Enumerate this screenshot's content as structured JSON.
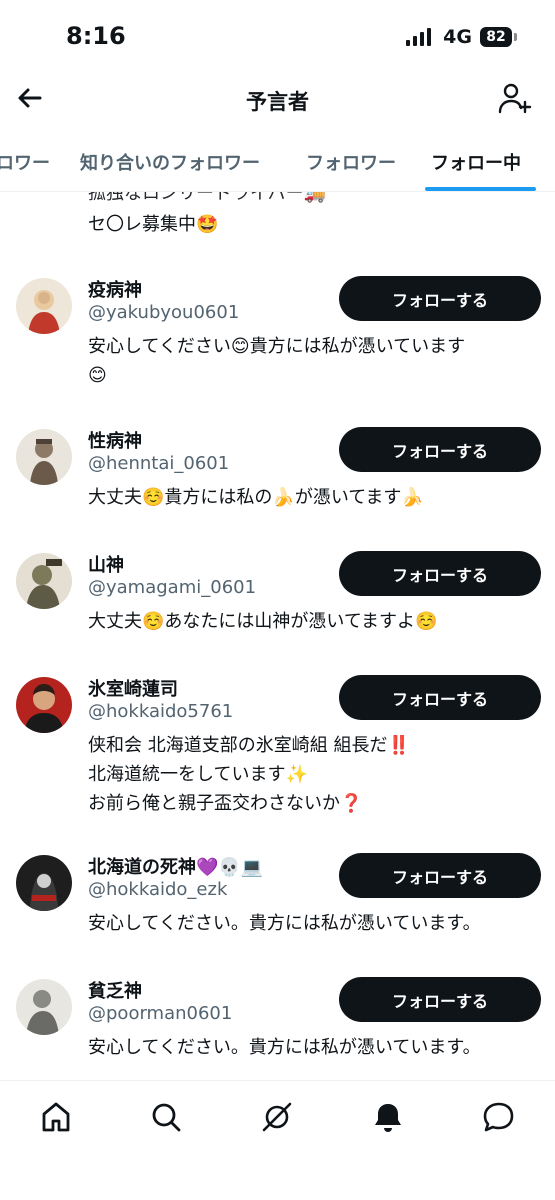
{
  "status_bar": {
    "time": "8:16",
    "network": "4G",
    "battery": "82"
  },
  "header": {
    "title": "予言者"
  },
  "tabs": [
    {
      "label": "ロワー"
    },
    {
      "label": "知り合いのフォロワー"
    },
    {
      "label": "フォロワー"
    },
    {
      "label": "フォロー中"
    }
  ],
  "partial_bio": {
    "line1": "孤独なロンリードライバー🚚",
    "line2": "セ〇レ募集中🤩"
  },
  "users": [
    {
      "name": "疫病神",
      "handle": "@yakubyou0601",
      "bio": [
        "安心してください😊貴方には私が憑いています",
        "😊"
      ],
      "button": "フォローする"
    },
    {
      "name": "性病神",
      "handle": "@henntai_0601",
      "bio": [
        "大丈夫☺️貴方には私の🍌が憑いてます🍌"
      ],
      "button": "フォローする"
    },
    {
      "name": "山神",
      "handle": "@yamagami_0601",
      "bio": [
        "大丈夫☺️あなたには山神が憑いてますよ☺️"
      ],
      "button": "フォローする"
    },
    {
      "name": "氷室崎蓮司",
      "handle": "@hokkaido5761",
      "bio": [
        "侠和会 北海道支部の氷室崎組 組長だ‼️",
        "北海道統一をしています✨",
        "お前ら俺と親子盃交わさないか❓"
      ],
      "button": "フォローする"
    },
    {
      "name": "北海道の死神💜💀💻",
      "handle": "@hokkaido_ezk",
      "bio": [
        "安心してください。貴方には私が憑いています。"
      ],
      "button": "フォローする"
    },
    {
      "name": "貧乏神",
      "handle": "@poorman0601",
      "bio": [
        "安心してください。貴方には私が憑いています。"
      ],
      "button": "フォローする"
    }
  ],
  "avatars": [
    {
      "icon": "red-deity-avatar",
      "bg": "#efe6da",
      "fg": "#c0392b"
    },
    {
      "icon": "statue-avatar",
      "bg": "#e9e4dc",
      "fg": "#6b5a4a"
    },
    {
      "icon": "mountain-god-avatar",
      "bg": "#e4dfd2",
      "fg": "#5d5a45"
    },
    {
      "icon": "man-portrait-avatar",
      "bg": "#b5231e",
      "fg": "#2b1d17"
    },
    {
      "icon": "reaper-avatar",
      "bg": "#1e1e1e",
      "fg": "#cfcfcf"
    },
    {
      "icon": "poverty-god-avatar",
      "bg": "#e8e6e0",
      "fg": "#6a6a66"
    }
  ],
  "bottom_nav": [
    "home-icon",
    "search-icon",
    "grok-icon",
    "notifications-icon",
    "messages-icon"
  ]
}
